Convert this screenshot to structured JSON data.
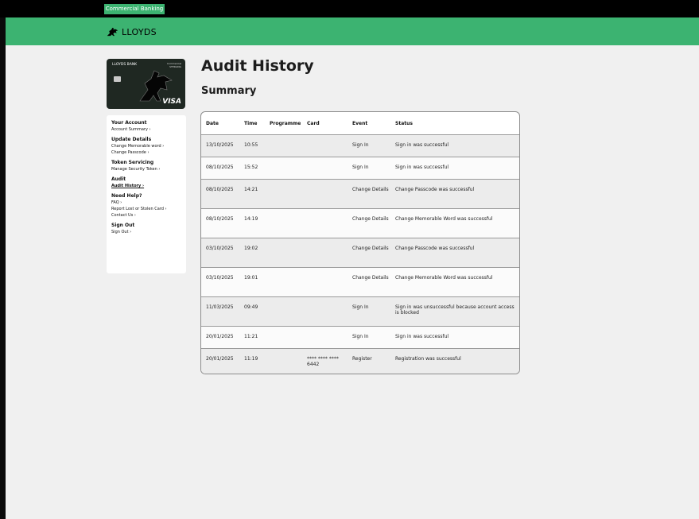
{
  "header": {
    "tab_label": "Commercial Banking",
    "brand_name": "LLOYDS",
    "brand_icon": "black-horse-icon",
    "brand_color": "#3cb371"
  },
  "card": {
    "bank_name": "LLOYDS BANK",
    "plan_line1": "Commercial",
    "plan_line2": "STERLING",
    "network": "VISA"
  },
  "sidebar": {
    "groups": [
      {
        "heading": "Your Account",
        "links": [
          "Account Summary ›"
        ]
      },
      {
        "heading": "Update Details",
        "links": [
          "Change Memorable word ›",
          "Change Passcode ›"
        ]
      },
      {
        "heading": "Token Servicing",
        "links": [
          "Manage Security Token ›"
        ]
      },
      {
        "heading": "Audit",
        "links": [
          "Audit History ›"
        ]
      },
      {
        "heading": "Need Help?",
        "links": [
          "FAQ ›",
          "Report Lost or Stolen Card ›",
          "Contact Us ›"
        ]
      },
      {
        "heading": "Sign Out",
        "links": [
          "Sign Out ›"
        ]
      }
    ]
  },
  "main": {
    "title": "Audit History",
    "section": "Summary",
    "table": {
      "columns": [
        "Date",
        "Time",
        "Programme",
        "Card",
        "Event",
        "Status"
      ],
      "rows": [
        [
          "13/10/2025",
          "10:55",
          "",
          "",
          "Sign In",
          "Sign in was successful"
        ],
        [
          "08/10/2025",
          "15:52",
          "",
          "",
          "Sign In",
          "Sign in was successful"
        ],
        [
          "08/10/2025",
          "14:21",
          "",
          "",
          "Change Details",
          "Change Passcode was successful"
        ],
        [
          "08/10/2025",
          "14:19",
          "",
          "",
          "Change Details",
          "Change Memorable Word was successful"
        ],
        [
          "03/10/2025",
          "19:02",
          "",
          "",
          "Change Details",
          "Change Passcode was successful"
        ],
        [
          "03/10/2025",
          "19:01",
          "",
          "",
          "Change Details",
          "Change Memorable Word was successful"
        ],
        [
          "11/03/2025",
          "09:49",
          "",
          "",
          "Sign In",
          "Sign in was unsuccessful because account access is blocked"
        ],
        [
          "20/01/2025",
          "11:21",
          "",
          "",
          "Sign In",
          "Sign in was successful"
        ],
        [
          "20/01/2025",
          "11:19",
          "",
          "**** **** **** 6442",
          "Register",
          "Registration was successful"
        ]
      ]
    }
  }
}
